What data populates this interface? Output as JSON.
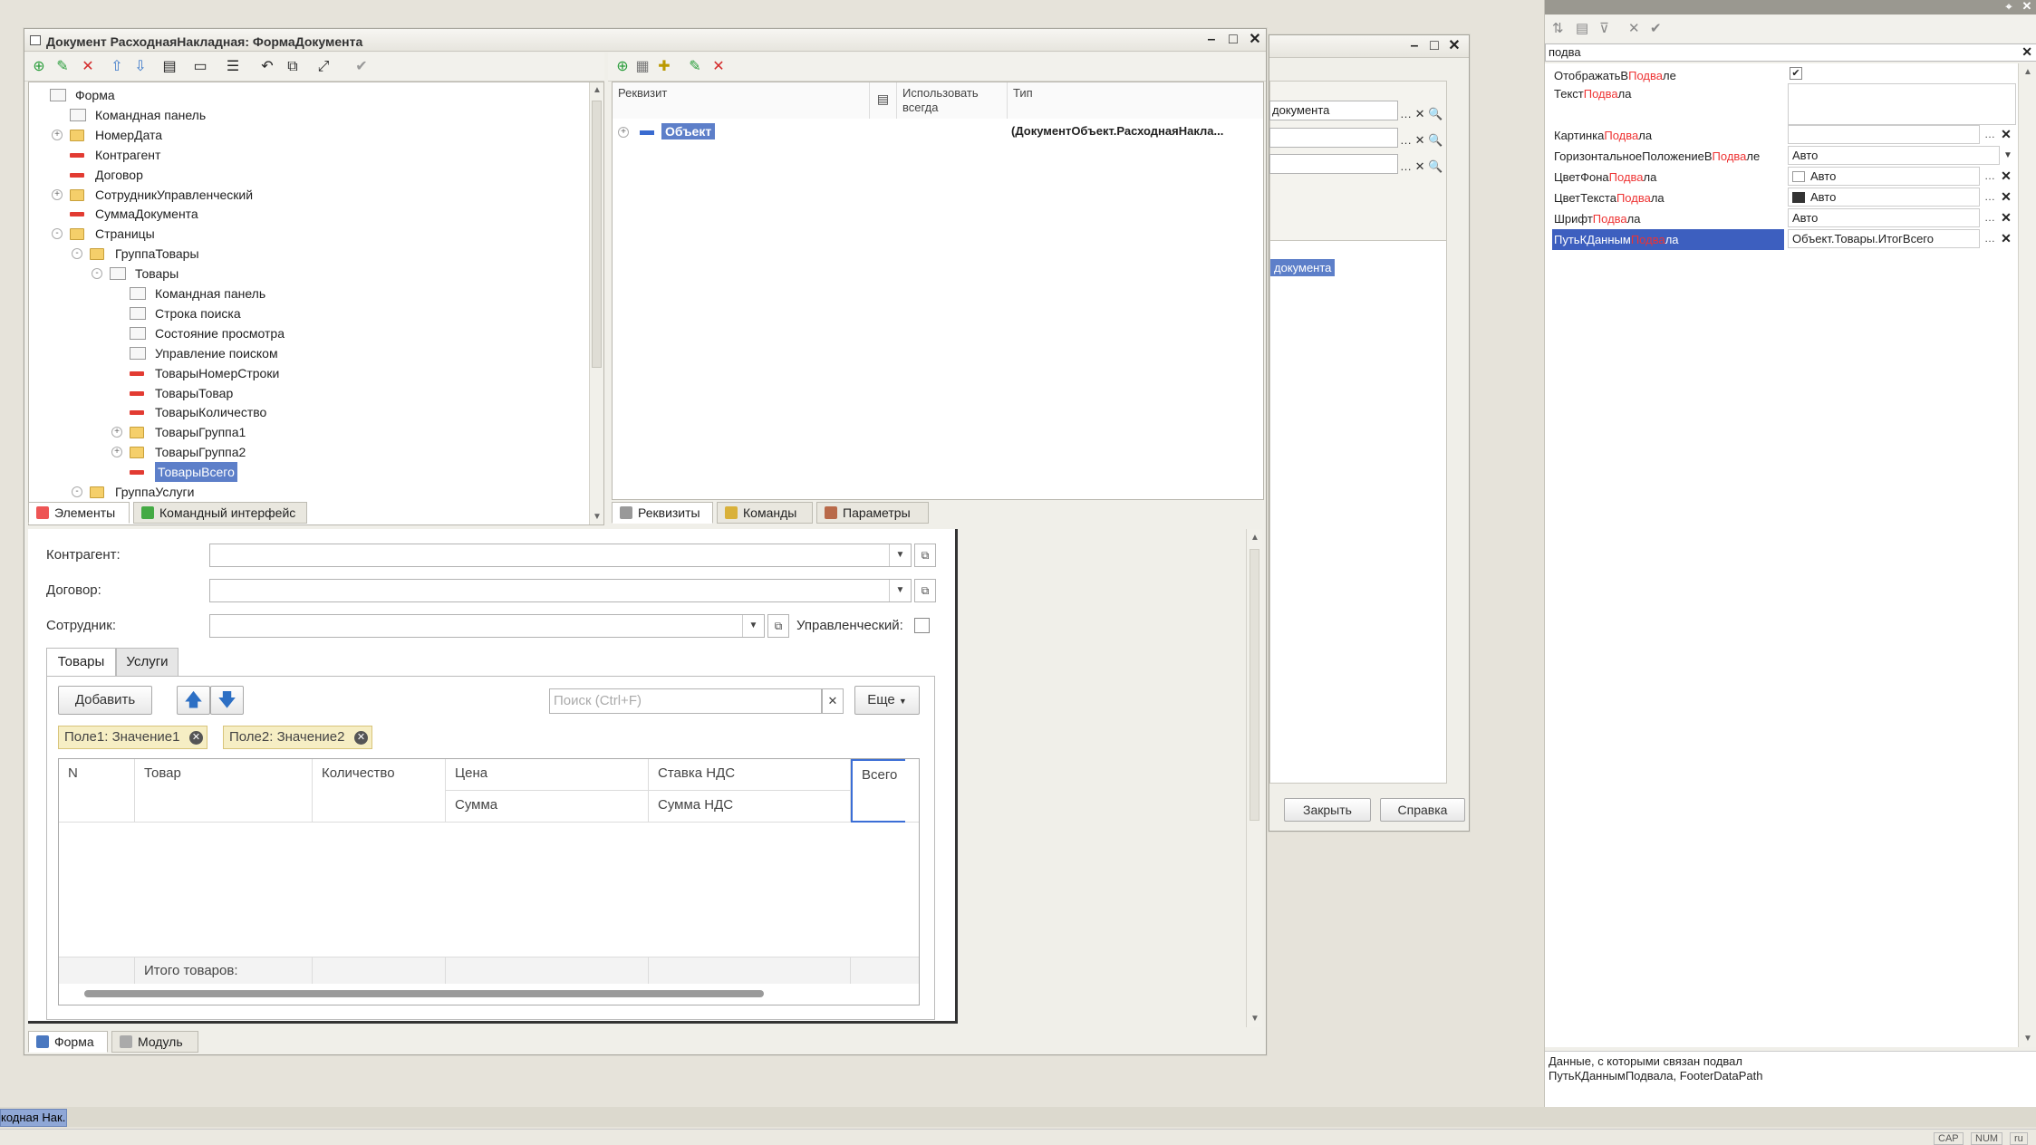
{
  "main_window": {
    "title": "Документ РасходнаяНакладная: ФормаДокумента"
  },
  "tree": {
    "items": [
      "Форма",
      "Командная панель",
      "НомерДата",
      "Контрагент",
      "Договор",
      "СотрудникУправленческий",
      "СуммаДокумента",
      "Страницы",
      "ГруппаТовары",
      "Товары",
      "Командная панель",
      "Строка поиска",
      "Состояние просмотра",
      "Управление поиском",
      "ТоварыНомерСтроки",
      "ТоварыТовар",
      "ТоварыКоличество",
      "ТоварыГруппа1",
      "ТоварыГруппа2",
      "ТоварыВсего",
      "ГруппаУслуги"
    ]
  },
  "left_tabs": [
    "Элементы",
    "Командный интерфейс"
  ],
  "attrs": {
    "col_requisite": "Реквизит",
    "col_use_always": "Использовать всегда",
    "col_type": "Тип",
    "row_name": "Объект",
    "row_type": "(ДокументОбъект.РасходнаяНакла..."
  },
  "right_tabs": [
    "Реквизиты",
    "Команды",
    "Параметры"
  ],
  "preview": {
    "contractor_label": "Контрагент:",
    "contract_label": "Договор:",
    "employee_label": "Сотрудник:",
    "managerial_label": "Управленческий:",
    "tab_goods": "Товары",
    "tab_services": "Услуги",
    "add_button": "Добавить",
    "search_placeholder": "Поиск (Ctrl+F)",
    "more_button": "Еще",
    "chip1": "Поле1: Значение1",
    "chip2": "Поле2: Значение2",
    "col_n": "N",
    "col_goods": "Товар",
    "col_qty": "Количество",
    "col_price": "Цена",
    "col_vat_rate": "Ставка НДС",
    "col_total": "Всего",
    "col_sum": "Сумма",
    "col_vat_sum": "Сумма НДС",
    "footer_total": "Итого товаров:"
  },
  "bottom_tabs": [
    "Форма",
    "Модуль"
  ],
  "back_window": {
    "field_text": "документа",
    "selected": "документа",
    "close_button": "Закрыть",
    "help_button": "Справка"
  },
  "props": {
    "search": "подва",
    "rows": [
      {
        "pre": "ОтображатьВ",
        "hl": "Подва",
        "post": "ле"
      },
      {
        "pre": "Текст",
        "hl": "Подва",
        "post": "ла"
      },
      {
        "pre": "Картинка",
        "hl": "Подва",
        "post": "ла"
      },
      {
        "pre": "ГоризонтальноеПоложениеВ",
        "hl": "Подва",
        "post": "ле"
      },
      {
        "pre": "ЦветФона",
        "hl": "Подва",
        "post": "ла"
      },
      {
        "pre": "ЦветТекста",
        "hl": "Подва",
        "post": "ла"
      },
      {
        "pre": "Шрифт",
        "hl": "Подва",
        "post": "ла"
      },
      {
        "pre": "ПутьКДанным",
        "hl": "Подва",
        "post": "ла"
      }
    ],
    "val_horiz": "Авто",
    "val_bg": "Авто",
    "val_fg": "Авто",
    "val_font": "Авто",
    "val_path": "Объект.Товары.ИтогВсего",
    "description_line1": "Данные, с которыми связан подвал",
    "description_line2": "ПутьКДаннымПодвала, FooterDataPath"
  },
  "taskbar": {
    "item": "кодная Нак..."
  },
  "status": [
    "CAP",
    "NUM",
    "ru"
  ],
  "colors": {
    "selection": "#3d5fbf",
    "tree_selection": "#5d7fc9",
    "highlight": "#e33333"
  }
}
